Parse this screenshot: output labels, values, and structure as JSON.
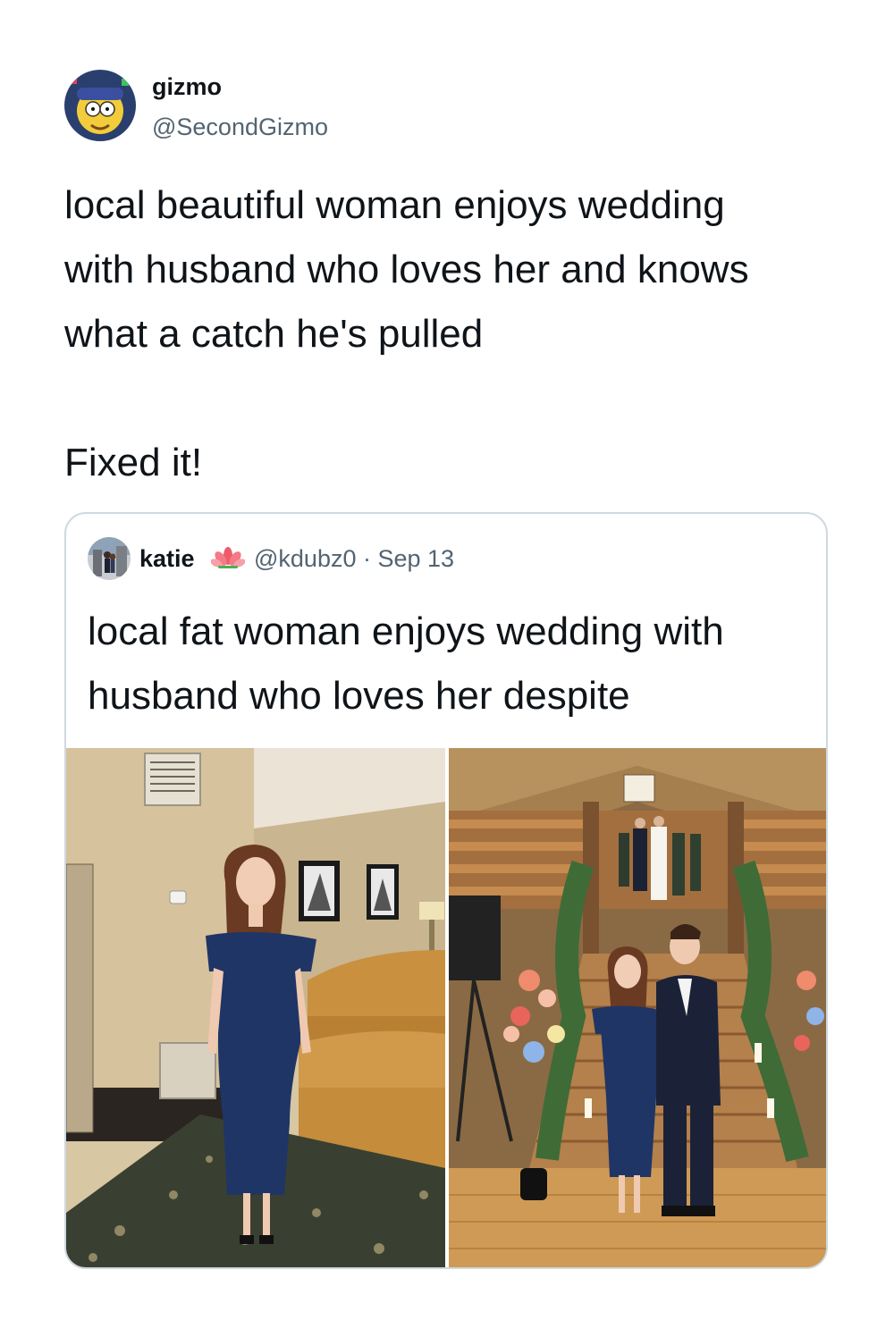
{
  "tweet": {
    "author": {
      "name": "gizmo",
      "handle": "@SecondGizmo",
      "avatar_icon": "cartoon-avatar"
    },
    "text_lines": [
      "local beautiful woman enjoys wedding",
      "with husband who loves her and knows",
      "what a catch he's pulled"
    ],
    "text_second": "Fixed it!"
  },
  "quoted": {
    "author": {
      "name": "katie",
      "emoji_icon": "lotus-icon",
      "handle_date": "@kdubz0 · Sep 13"
    },
    "text_lines": [
      "local fat woman enjoys wedding with",
      "husband who loves her despite"
    ],
    "media": [
      {
        "description_icon": "photo-woman-in-blue-dress-living-room"
      },
      {
        "description_icon": "photo-couple-at-wedding-staircase"
      }
    ]
  },
  "colors": {
    "text_primary": "#0f1419",
    "text_secondary": "#536471",
    "card_border": "#cfd9de",
    "dress_blue": "#1f3566"
  }
}
